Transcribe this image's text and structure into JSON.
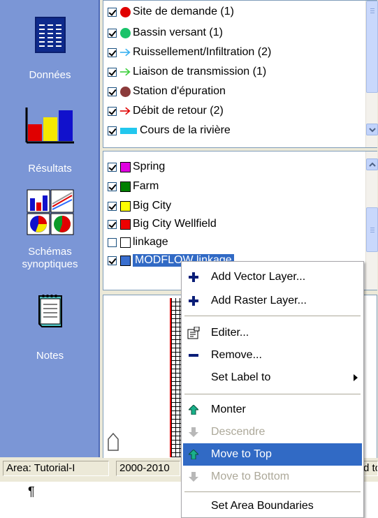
{
  "sidebar": {
    "items": [
      {
        "label": "Données",
        "icon": "data-table-icon"
      },
      {
        "label": "Résultats",
        "icon": "bar-chart-icon"
      },
      {
        "label": "Schémas synoptiques",
        "icon": "charts-grid-icon"
      },
      {
        "label": "Notes",
        "icon": "notepad-icon"
      }
    ]
  },
  "upper_legend": {
    "rows": [
      {
        "label": "Site de demande (1)",
        "symbol": "red-circle",
        "color": "#e00000",
        "checked": true
      },
      {
        "label": "Bassin versant (1)",
        "symbol": "green-circle",
        "color": "#19c36a",
        "checked": true
      },
      {
        "label": "Ruissellement/Infiltration (2)",
        "symbol": "blue-arrow",
        "color": "#38b0f0",
        "checked": true
      },
      {
        "label": "Liaison de transmission (1)",
        "symbol": "green-arrow",
        "color": "#3ccf3c",
        "checked": true
      },
      {
        "label": "Station d'épuration",
        "symbol": "brown-circle",
        "color": "#8b3a3a",
        "checked": true
      },
      {
        "label": "Débit de retour (2)",
        "symbol": "red-arrow",
        "color": "#e00000",
        "checked": true
      },
      {
        "label": "Cours de la rivière",
        "symbol": "cyan-bar",
        "color": "#22c7ee",
        "checked": true
      }
    ]
  },
  "lower_legend": {
    "rows": [
      {
        "label": "Spring",
        "color": "#e000e0",
        "checked": true
      },
      {
        "label": "Farm",
        "color": "#008000",
        "checked": true
      },
      {
        "label": "Big City",
        "color": "#ffff00",
        "checked": true
      },
      {
        "label": "Big City Wellfield",
        "color": "#ee0000",
        "checked": true
      },
      {
        "label": "linkage",
        "color": "#ffffff",
        "checked": false
      },
      {
        "label": "MODFLOW linkage",
        "color": "#3a6fcf",
        "checked": true
      }
    ]
  },
  "status": {
    "area": "Area: Tutorial-I",
    "years": "2000-2010",
    "last": "d to"
  },
  "document": {
    "pilcrow": "¶"
  },
  "context_menu": {
    "items": [
      {
        "label": "Add Vector Layer...",
        "icon": "plus-icon",
        "state": "normal"
      },
      {
        "label": "Add Raster Layer...",
        "icon": "plus-icon",
        "state": "normal"
      },
      {
        "label": "Editer...",
        "icon": "properties-icon",
        "state": "normal"
      },
      {
        "label": "Remove...",
        "icon": "minus-icon",
        "state": "normal"
      },
      {
        "label": "Set Label to",
        "icon": "",
        "state": "submenu"
      },
      {
        "label": "Monter",
        "icon": "arrow-up-icon",
        "state": "normal"
      },
      {
        "label": "Descendre",
        "icon": "arrow-down-icon",
        "state": "disabled"
      },
      {
        "label": "Move to Top",
        "icon": "arrow-up-icon",
        "state": "highlighted"
      },
      {
        "label": "Move to Bottom",
        "icon": "arrow-down-icon",
        "state": "disabled"
      },
      {
        "label": "Set Area Boundaries",
        "icon": "",
        "state": "normal"
      }
    ]
  }
}
